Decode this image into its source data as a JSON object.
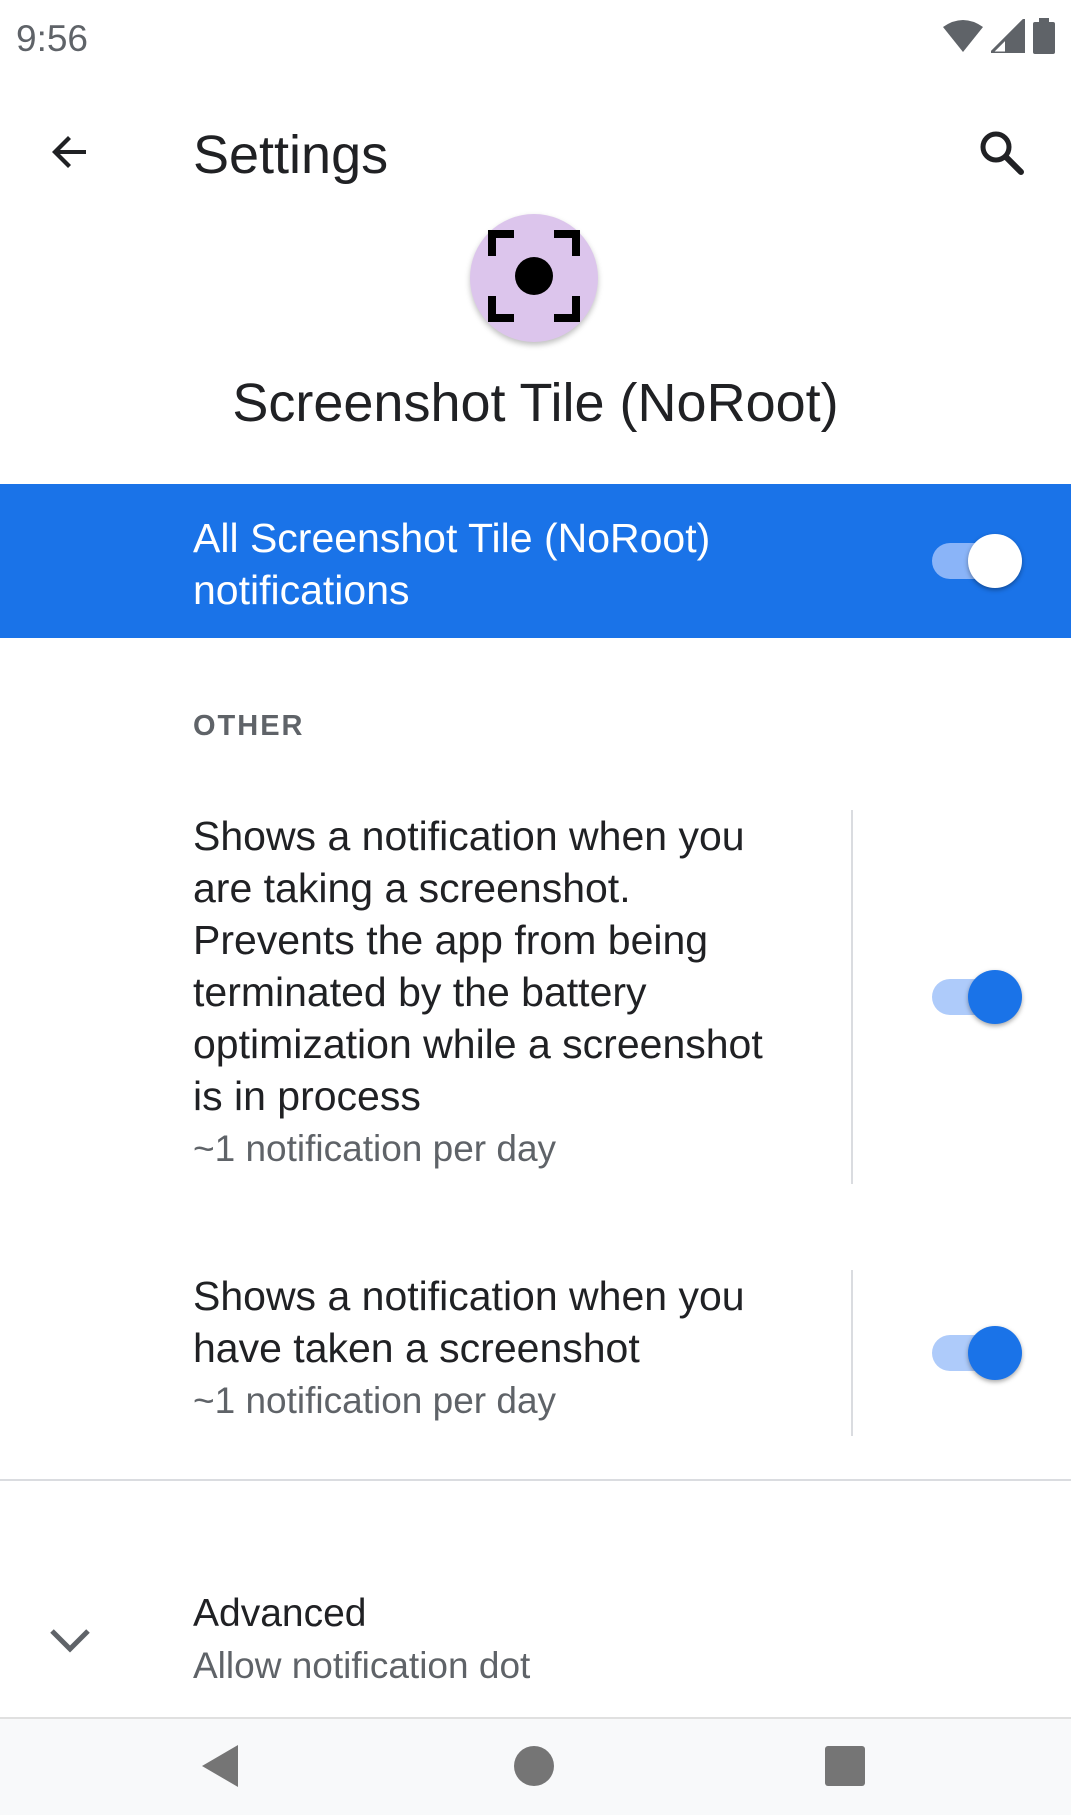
{
  "status_bar": {
    "time": "9:56",
    "icons": [
      "wifi-icon",
      "cell-signal-icon",
      "battery-icon"
    ]
  },
  "toolbar": {
    "title": "Settings",
    "back_icon": "arrow-back-icon",
    "search_icon": "search-icon"
  },
  "app": {
    "name": "Screenshot Tile (NoRoot)",
    "icon": "screenshot-frame-icon",
    "icon_bg": "#dcc5ec"
  },
  "master_toggle": {
    "label": "All Screenshot Tile (NoRoot) notifications",
    "enabled": true,
    "bg_color": "#1a73e8"
  },
  "section": {
    "header": "OTHER"
  },
  "channels": [
    {
      "title": "Shows a notification when you are taking a screenshot. Prevents the app from being terminated by the battery optimization while a screenshot is in process",
      "summary": "~1 notification per day",
      "enabled": true
    },
    {
      "title": "Shows a notification when you have taken a screenshot",
      "summary": "~1 notification per day",
      "enabled": true
    }
  ],
  "advanced": {
    "title": "Advanced",
    "summary": "Allow notification dot"
  },
  "nav_bar": {
    "icons": [
      "back-triangle-icon",
      "home-circle-icon",
      "recents-square-icon"
    ]
  },
  "colors": {
    "accent": "#1a73e8",
    "text_primary": "#202124",
    "text_secondary": "#5f6368"
  }
}
